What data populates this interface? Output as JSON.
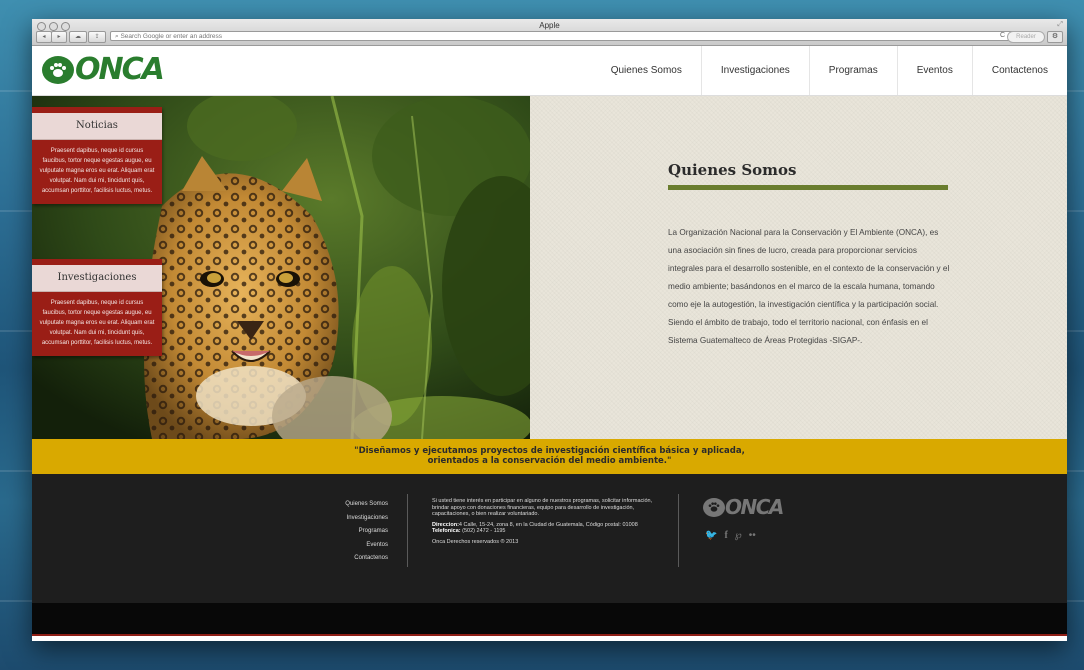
{
  "browser": {
    "title": "Apple",
    "address_placeholder": "Search Google or enter an address",
    "reader_label": "Reader"
  },
  "header": {
    "logo_text": "ONCA",
    "nav": [
      "Quienes Somos",
      "Investigaciones",
      "Programas",
      "Eventos",
      "Contactenos"
    ]
  },
  "sidebar_cards": [
    {
      "title": "Noticias",
      "body": "Praesent dapibus, neque id cursus faucibus, tortor neque egestas augue, eu vulputate magna eros eu erat. Aliquam erat volutpat. Nam dui mi, tincidunt quis, accumsan porttitor, facilisis luctus, metus."
    },
    {
      "title": "Investigaciones",
      "body": "Praesent dapibus, neque id cursus faucibus, tortor neque egestas augue, eu vulputate magna eros eu erat. Aliquam erat volutpat. Nam dui mi, tincidunt quis, accumsan porttitor, facilisis luctus, metus."
    }
  ],
  "about": {
    "title": "Quienes Somos",
    "body": "La Organización Nacional para la Conservación y El Ambiente (ONCA), es una asociación sin fines de lucro, creada para proporcionar servicios integrales para el desarrollo sostenible, en el contexto de la conservación y el medio ambiente; basándonos en el marco de la escala humana, tomando como eje la autogestión, la investigación científica y la participación social. Siendo el ámbito de trabajo, todo el territorio nacional, con énfasis en el Sistema Guatemalteco de Áreas Protegidas -SIGAP-."
  },
  "quote": {
    "line1": "\"Diseñamos y ejecutamos proyectos de investigación científica básica y aplicada,",
    "line2": "orientados a la conservación del medio ambiente.\""
  },
  "footer": {
    "links": [
      "Quienes Somos",
      "Investigaciones",
      "Programas",
      "Eventos",
      "Contactenos"
    ],
    "invite": "Si usted tiene interés en participar en alguno de nuestros programas, solicitar información, brindar apoyo con donaciones financieras, equipo para desarrollo de investigación, capacitaciones, o bien realizar voluntariado.",
    "address_label": "Direccion:",
    "address": "4 Calle, 15-24, zona 8, en la Ciudad de Guatemala, Código postal: 01008",
    "phone_label": "Telefonica:",
    "phone": "(502) 2472 - 1195",
    "copyright": "Onca Derechos reservados ® 2013",
    "logo_text": "ONCA",
    "social_icons": [
      "twitter-icon",
      "facebook-icon",
      "pinterest-icon",
      "flickr-icon"
    ]
  }
}
